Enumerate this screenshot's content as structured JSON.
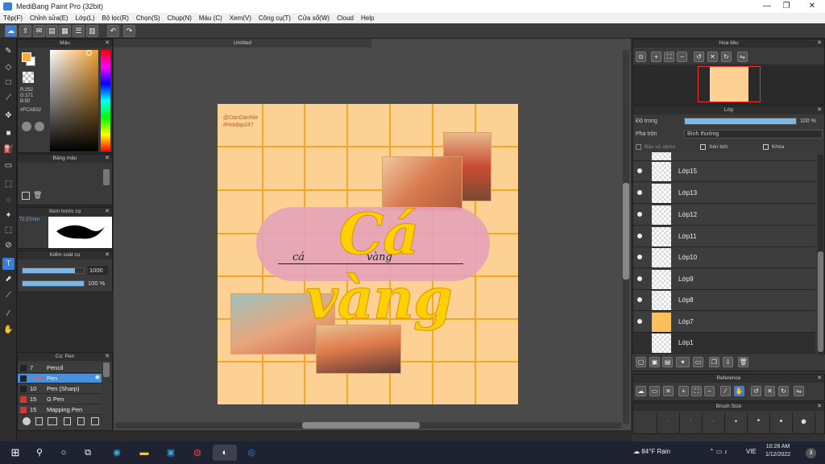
{
  "window": {
    "title": "MediBang Paint Pro (32bit)"
  },
  "menu": [
    "Tệp(F)",
    "Chỉnh sửa(E)",
    "Lớp(L)",
    "Bộ lọc(R)",
    "Chọn(S)",
    "Chụp(N)",
    "Màu (C)",
    "Xem(V)",
    "Công cụ(T)",
    "Cửa sổ(W)",
    "Cloud",
    "Help"
  ],
  "color_panel": {
    "title": "Màu",
    "r": "R:252",
    "g": "G:171",
    "b": "B:50",
    "hex": "#FCAB32",
    "foreground": "#fcab32"
  },
  "palette_panel": {
    "title": "Bảng màu"
  },
  "brush_preview": {
    "title": "Xem trước cọ",
    "size": "72.57mm"
  },
  "brush_control": {
    "title": "Kiểm soát cọ",
    "size": "1000",
    "opacity": "100 %",
    "size_level": 0.85,
    "opacity_level": 1.0
  },
  "brush_list": {
    "title": "Cọ: Pen",
    "items": [
      {
        "size": "7",
        "name": "Pencil",
        "color": "#333"
      },
      {
        "size": "1000",
        "name": "Pen",
        "color": "#1a73c9",
        "selected": true
      },
      {
        "size": "10",
        "name": "Pen (Sharp)",
        "color": "#333"
      },
      {
        "size": "15",
        "name": "G Pen",
        "color": "#d33"
      },
      {
        "size": "15",
        "name": "Mapping Pen",
        "color": "#d33"
      }
    ]
  },
  "document": {
    "tab": "Untitled"
  },
  "artwork": {
    "handle1": "@DanDanNie",
    "handle2": "#Hoidap247",
    "big_text": "Cá vàng",
    "script1": "cá",
    "script2": "vàng"
  },
  "navigator": {
    "title": "Hoa tiêu"
  },
  "layers_panel": {
    "title": "Lớp",
    "opacity_label": "Độ trong",
    "opacity_value": "100 %",
    "opacity_level": 1.0,
    "blend_label": "Pha trộn",
    "blend_value": "Bình thường",
    "opt_alpha": "Bảo vệ alpha",
    "opt_clip": "Xén bớt",
    "opt_lock": "Khóa",
    "layers": [
      "Lớp15",
      "Lớp13",
      "Lớp12",
      "Lớp11",
      "Lớp10",
      "Lớp9",
      "Lớp8",
      "Lớp7",
      "Lớp1"
    ]
  },
  "reference_panel": {
    "title": "Reference"
  },
  "brush_size_panel": {
    "title": "Brush Size"
  },
  "taskbar": {
    "weather": "84°F Rain",
    "lang": "VIE",
    "time": "10:28 AM",
    "date": "1/12/2022",
    "notif": "3"
  }
}
